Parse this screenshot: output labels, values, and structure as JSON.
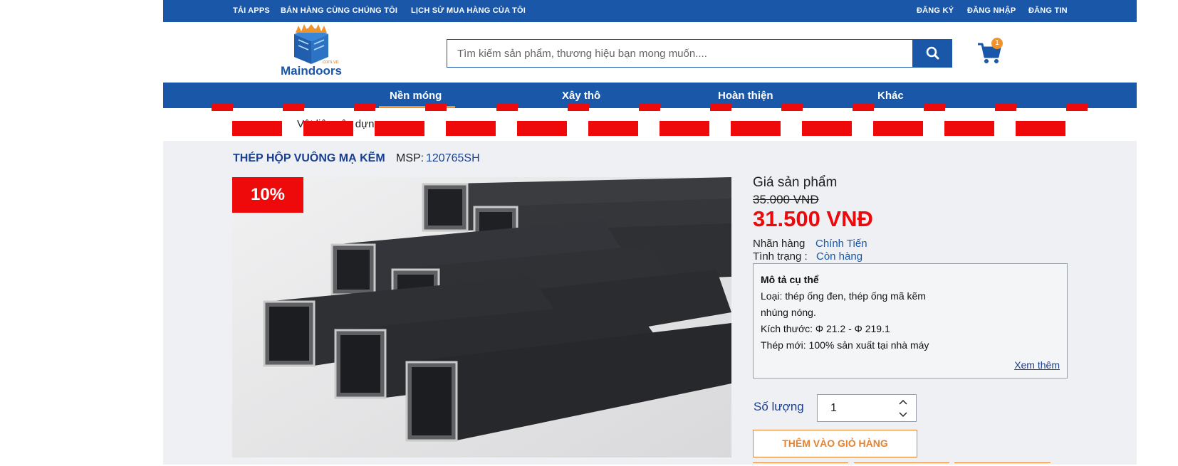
{
  "topbar": {
    "left_links": [
      "TẢI APPS",
      "BÁN HÀNG CÙNG CHÚNG TÔI",
      "LỊCH SỬ MUA HÀNG CỦA TÔI"
    ],
    "right_links": [
      "ĐĂNG KÝ",
      "ĐĂNG NHẬP",
      "ĐĂNG TIN"
    ]
  },
  "header": {
    "logo_text": "Maindoors",
    "logo_sub": ".com.vn",
    "search_placeholder": "Tìm kiếm sản phẩm, thương hiệu bạn mong muốn....",
    "cart_count": "1"
  },
  "nav": {
    "items": [
      "Nền móng",
      "Xây thô",
      "Hoàn thiện",
      "Khác"
    ],
    "active": "Nền móng"
  },
  "breadcrumb": {
    "home": "",
    "current": "Vật liệu xây dựng"
  },
  "product": {
    "title": "THÉP HỘP VUÔNG MẠ KẼM",
    "msp_label": "MSP:",
    "msp_value": "120765SH",
    "discount": "10%",
    "price_label": "Giá sản phẩm",
    "old_price": "35.000 VNĐ",
    "new_price": "31.500 VNĐ",
    "brand_label": "Nhãn hàng",
    "brand_value": "Chính Tiến",
    "status_label": "Tình trạng :",
    "status_value": "Còn hàng",
    "description": {
      "title": "Mô tả cụ thể",
      "lines": [
        "Loại: thép ống đen, thép ống mã kẽm",
        "nhúng nóng.",
        "Kích thước: Φ 21.2 - Φ 219.1",
        "Thép mới: 100% sản xuất tại nhà máy"
      ],
      "more_label": "Xem thêm"
    },
    "quantity_label": "Số lượng",
    "quantity_value": "1",
    "add_to_cart_label": "THÊM VÀO GIỎ HÀNG"
  },
  "colors": {
    "brand_blue": "#1a57a8",
    "accent_orange": "#e8822d",
    "sale_red": "#ee0a0a"
  }
}
